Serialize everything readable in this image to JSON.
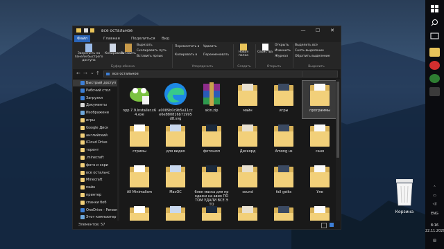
{
  "window": {
    "title": "все остальное",
    "tabs": [
      "Файл",
      "Главная",
      "Поделиться",
      "Вид"
    ],
    "controls": {
      "minimize": "—",
      "maximize": "☐",
      "close": "✕"
    }
  },
  "ribbon": {
    "pin_label": "Закрепить на панели быстрого доступа",
    "copy_label": "Копировать",
    "paste_label": "Вставить",
    "cut_label": "Вырезать",
    "copy_path_label": "Скопировать путь",
    "paste_shortcut_label": "Вставить ярлык",
    "clipboard_group": "Буфер обмена",
    "move_to_label": "Переместить в",
    "copy_to_label": "Копировать в",
    "delete_label": "Удалить",
    "rename_label": "Переименовать",
    "organize_group": "Упорядочить",
    "new_folder_label": "Новая папка",
    "create_group": "Создать",
    "properties_label": "Свойства",
    "open_label": "Открыть",
    "edit_label": "Изменить",
    "history_label": "Журнал",
    "open_group": "Открыть",
    "select_all_label": "Выделить все",
    "select_none_label": "Снять выделение",
    "invert_selection_label": "Обратить выделение",
    "select_group": "Выделить"
  },
  "address": {
    "path": "все остальное",
    "back": "←",
    "forward": "→",
    "recent": "⌄",
    "up": "↑"
  },
  "nav": {
    "items": [
      {
        "label": "Быстрый доступ",
        "color": "#3d7fd6",
        "selected": true
      },
      {
        "label": "Рабочий стол",
        "color": "#3d7fd6",
        "selected": false
      },
      {
        "label": "Загрузки",
        "color": "#3d7fd6",
        "selected": false
      },
      {
        "label": "Документы",
        "color": "#d8d8d8",
        "selected": false
      },
      {
        "label": "Изображени",
        "color": "#6fa8dc",
        "selected": false
      },
      {
        "label": "игры",
        "color": "#f2d07a",
        "selected": false
      },
      {
        "label": "Google Диск",
        "color": "#f2d07a",
        "selected": false
      },
      {
        "label": "английский",
        "color": "#f2d07a",
        "selected": false
      },
      {
        "label": "iCloud Drive",
        "color": "#f2d07a",
        "selected": false
      },
      {
        "label": "торент",
        "color": "#f2d07a",
        "selected": false
      },
      {
        "label": ".minecraft",
        "color": "#f2d07a",
        "selected": false
      },
      {
        "label": "фото и скри",
        "color": "#f2d07a",
        "selected": false
      },
      {
        "label": "все остальнс",
        "color": "#f2d07a",
        "selected": false
      },
      {
        "label": "Minecraft",
        "color": "#f2d07a",
        "selected": false
      },
      {
        "label": "майн",
        "color": "#f2d07a",
        "selected": false
      },
      {
        "label": "принтер",
        "color": "#f2d07a",
        "selected": false
      },
      {
        "label": "спанки боб",
        "color": "#f2d07a",
        "selected": false
      },
      {
        "label": "OneDrive - Person",
        "color": "#3d7fd6",
        "selected": false
      },
      {
        "label": "Этот компьютер",
        "color": "#6fa8dc",
        "selected": false
      }
    ]
  },
  "files": [
    {
      "name": "npp.7.9.Installer.x64.exe",
      "kind": "npp",
      "selected": false
    },
    {
      "name": "a0089b0c9b5a11cce6e880816b71995d8.svg",
      "kind": "edge",
      "selected": false
    },
    {
      "name": "skin.zip",
      "kind": "zip",
      "selected": false
    },
    {
      "name": "майн",
      "kind": "folder",
      "selected": false
    },
    {
      "name": "игры",
      "kind": "folder",
      "selected": false
    },
    {
      "name": "программы",
      "kind": "folder",
      "selected": true
    },
    {
      "name": "стримы",
      "kind": "folder",
      "selected": false
    },
    {
      "name": "для видео",
      "kind": "folder",
      "selected": false
    },
    {
      "name": "фотошоп",
      "kind": "folder",
      "selected": false
    },
    {
      "name": "Дискорд",
      "kind": "folder",
      "selected": false
    },
    {
      "name": "Among us",
      "kind": "folder",
      "selected": false
    },
    {
      "name": "саня",
      "kind": "folder",
      "selected": false
    },
    {
      "name": "All Minimalism",
      "kind": "folder",
      "selected": false
    },
    {
      "name": "MacOC",
      "kind": "folder",
      "selected": false
    },
    {
      "name": "блек маска для продажи на авио ПОТОМ УДАЛИ ВСЕ ЭТО",
      "kind": "folder",
      "selected": false
    },
    {
      "name": "sound",
      "kind": "folder",
      "selected": false
    },
    {
      "name": "fall geiks",
      "kind": "folder",
      "selected": false
    },
    {
      "name": "Уле",
      "kind": "folder",
      "selected": false
    },
    {
      "name": "",
      "kind": "folder",
      "selected": false
    },
    {
      "name": "",
      "kind": "folder",
      "selected": false
    },
    {
      "name": "",
      "kind": "folder",
      "selected": false
    },
    {
      "name": "",
      "kind": "folder",
      "selected": false
    },
    {
      "name": "",
      "kind": "folder",
      "selected": false
    },
    {
      "name": "",
      "kind": "folder",
      "selected": false
    }
  ],
  "status": {
    "count_text": "Элементов: 57"
  },
  "desktop": {
    "recycle_bin_label": "Корзина"
  },
  "taskbar": {
    "language": "ENG",
    "time": "8:16",
    "date": "22.11.2020"
  }
}
